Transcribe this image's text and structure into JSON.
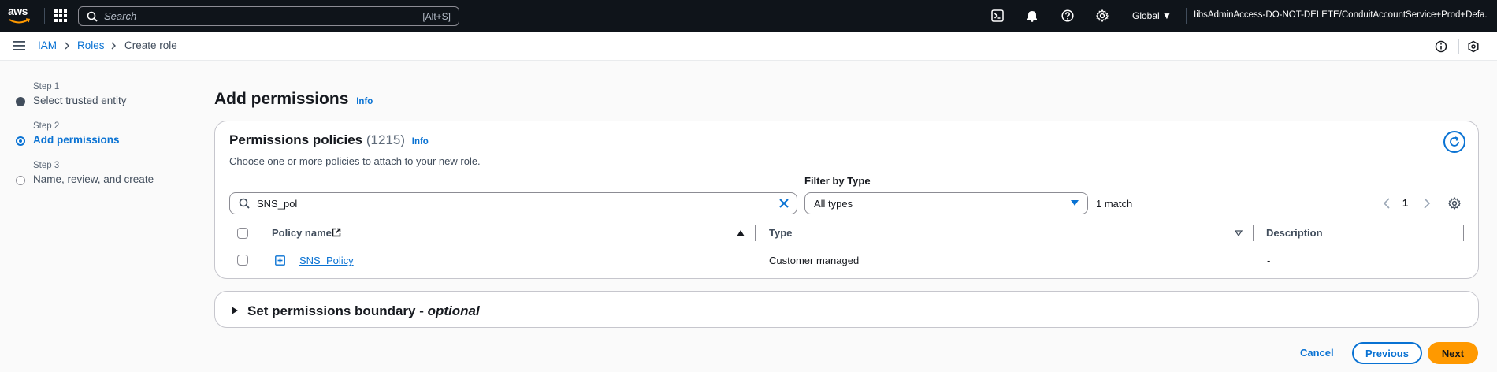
{
  "topnav": {
    "logo_text": "aws",
    "search_placeholder": "Search",
    "search_shortcut": "[Alt+S]",
    "region": "Global",
    "account": "IibsAdminAccess-DO-NOT-DELETE/ConduitAccountService+Prod+Defa..."
  },
  "breadcrumb": {
    "items": [
      {
        "label": "IAM"
      },
      {
        "label": "Roles"
      },
      {
        "label": "Create role"
      }
    ]
  },
  "steps": [
    {
      "step": "Step 1",
      "label": "Select trusted entity"
    },
    {
      "step": "Step 2",
      "label": "Add permissions"
    },
    {
      "step": "Step 3",
      "label": "Name, review, and create"
    }
  ],
  "page": {
    "title": "Add permissions",
    "info": "Info"
  },
  "policies": {
    "title": "Permissions policies",
    "count": "(1215)",
    "info": "Info",
    "description": "Choose one or more policies to attach to your new role.",
    "filter_label": "Filter by Type",
    "search_value": "SNS_pol",
    "type_selected": "All types",
    "match_text": "1 match",
    "page_number": "1",
    "columns": [
      "Policy name",
      "Type",
      "Description"
    ],
    "rows": [
      {
        "name": "SNS_Policy",
        "type": "Customer managed",
        "description": "-"
      }
    ]
  },
  "boundary": {
    "title": "Set permissions boundary - ",
    "optional": "optional"
  },
  "footer": {
    "cancel": "Cancel",
    "previous": "Previous",
    "next": "Next"
  },
  "colors": {
    "nav_bg": "#0f141a",
    "link": "#0972d3",
    "primary_button": "#ff9900"
  }
}
